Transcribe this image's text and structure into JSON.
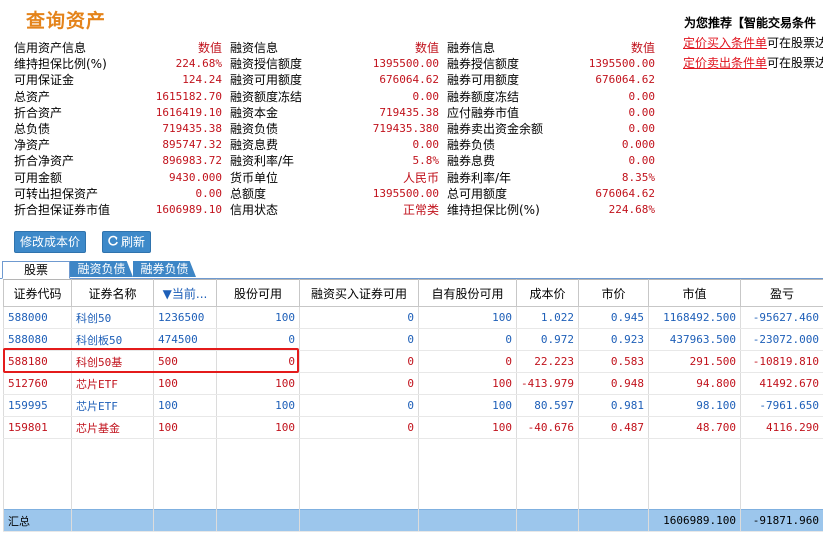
{
  "page_title": "查询资产",
  "recommend": {
    "title": "为您推荐【智能交易条件",
    "links": [
      {
        "link_text": "定价买入条件单",
        "rest": "可在股票达"
      },
      {
        "link_text": "定价卖出条件单",
        "rest": "可在股票达"
      }
    ]
  },
  "credit_info": {
    "header": {
      "label": "信用资产信息",
      "value": "数值"
    },
    "rows": [
      {
        "label": "维持担保比例(%)",
        "value": "224.68%"
      },
      {
        "label": "可用保证金",
        "value": "124.24"
      },
      {
        "label": "总资产",
        "value": "1615182.70"
      },
      {
        "label": "折合资产",
        "value": "1616419.10"
      },
      {
        "label": "总负债",
        "value": "719435.38"
      },
      {
        "label": "净资产",
        "value": "895747.32"
      },
      {
        "label": "折合净资产",
        "value": "896983.72"
      },
      {
        "label": "可用金额",
        "value": "9430.000"
      },
      {
        "label": "可转出担保资产",
        "value": "0.00"
      },
      {
        "label": "折合担保证券市值",
        "value": "1606989.10"
      }
    ]
  },
  "margin_info": {
    "header": {
      "label": "融资信息",
      "value": "数值"
    },
    "rows": [
      {
        "label": "融资授信额度",
        "value": "1395500.00"
      },
      {
        "label": "融资可用额度",
        "value": "676064.62"
      },
      {
        "label": "融资额度冻结",
        "value": "0.00"
      },
      {
        "label": "融资本金",
        "value": "719435.38"
      },
      {
        "label": "融资负债",
        "value": "719435.380"
      },
      {
        "label": "融资息费",
        "value": "0.00"
      },
      {
        "label": "融资利率/年",
        "value": "5.8%"
      },
      {
        "label": "货币单位",
        "value": "人民币"
      },
      {
        "label": "总额度",
        "value": "1395500.00"
      },
      {
        "label": "信用状态",
        "value": "正常类"
      }
    ]
  },
  "short_info": {
    "header": {
      "label": "融券信息",
      "value": "数值"
    },
    "rows": [
      {
        "label": "融券授信额度",
        "value": "1395500.00"
      },
      {
        "label": "融券可用额度",
        "value": "676064.62"
      },
      {
        "label": "融券额度冻结",
        "value": "0.00"
      },
      {
        "label": "应付融券市值",
        "value": "0.00"
      },
      {
        "label": "融券卖出资金余额",
        "value": "0.00"
      },
      {
        "label": "融券负债",
        "value": "0.000"
      },
      {
        "label": "融券息费",
        "value": "0.00"
      },
      {
        "label": "融券利率/年",
        "value": "8.35%"
      },
      {
        "label": "总可用额度",
        "value": "676064.62"
      },
      {
        "label": "维持担保比例(%)",
        "value": "224.68%"
      }
    ]
  },
  "buttons": {
    "modify_cost": "修改成本价",
    "refresh": "刷新",
    "refresh_icon": "refresh-icon"
  },
  "tabs": [
    "股票",
    "融资负债",
    "融券负债"
  ],
  "table": {
    "headers": [
      "证券代码",
      "证券名称",
      "▼当前...",
      "股份可用",
      "融资买入证券可用",
      "自有股份可用",
      "成本价",
      "市价",
      "市值",
      "盈亏"
    ],
    "rows": [
      {
        "color": "blue",
        "cells": [
          "588000",
          "科创50",
          "1236500",
          "100",
          "0",
          "100",
          "1.022",
          "0.945",
          "1168492.500",
          "-95627.460"
        ]
      },
      {
        "color": "blue",
        "cells": [
          "588080",
          "科创板50",
          "474500",
          "0",
          "0",
          "0",
          "0.972",
          "0.923",
          "437963.500",
          "-23072.000"
        ]
      },
      {
        "color": "red",
        "cells": [
          "588180",
          "科创50基",
          "500",
          "0",
          "0",
          "0",
          "22.223",
          "0.583",
          "291.500",
          "-10819.810"
        ]
      },
      {
        "color": "red",
        "cells": [
          "512760",
          "芯片ETF",
          "100",
          "100",
          "0",
          "100",
          "-413.979",
          "0.948",
          "94.800",
          "41492.670"
        ]
      },
      {
        "color": "blue",
        "cells": [
          "159995",
          "芯片ETF",
          "100",
          "100",
          "0",
          "100",
          "80.597",
          "0.981",
          "98.100",
          "-7961.650"
        ]
      },
      {
        "color": "red",
        "cells": [
          "159801",
          "芯片基金",
          "100",
          "100",
          "0",
          "100",
          "-40.676",
          "0.487",
          "48.700",
          "4116.290"
        ]
      }
    ],
    "total": {
      "label": "汇总",
      "market_value": "1606989.100",
      "profit_loss": "-91871.960"
    }
  },
  "colors": {
    "accent_title": "#e4831a",
    "value_red": "#c1121c",
    "row_blue": "#1e5fb8",
    "button_blue": "#3d89c9",
    "total_bar": "#9cc6ec",
    "highlight_border": "#e41b1b"
  }
}
